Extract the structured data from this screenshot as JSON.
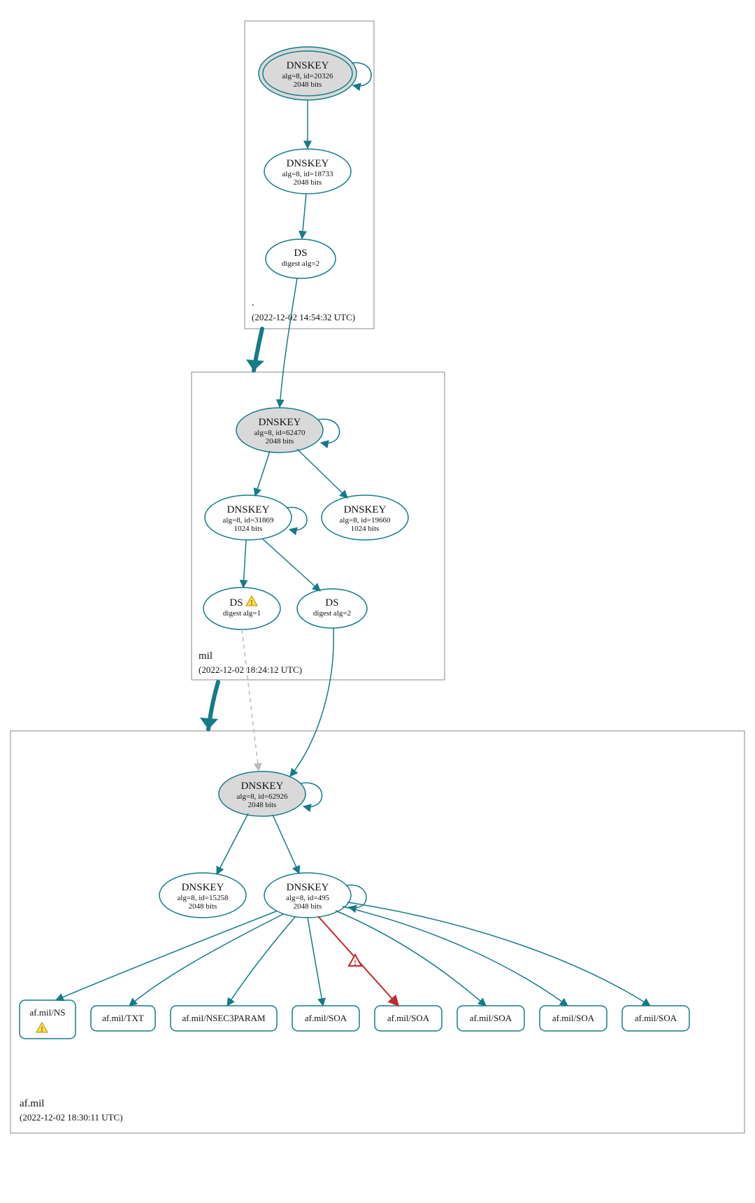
{
  "zones": {
    "root": {
      "label": ".",
      "timestamp": "(2022-12-02 14:54:32 UTC)"
    },
    "mil": {
      "label": "mil",
      "timestamp": "(2022-12-02 18:24:12 UTC)"
    },
    "afmil": {
      "label": "af.mil",
      "timestamp": "(2022-12-02 18:30:11 UTC)"
    }
  },
  "nodes": {
    "root_ksk": {
      "title": "DNSKEY",
      "sub1": "alg=8, id=20326",
      "sub2": "2048 bits"
    },
    "root_zsk": {
      "title": "DNSKEY",
      "sub1": "alg=8, id=18733",
      "sub2": "2048 bits"
    },
    "root_ds": {
      "title": "DS",
      "sub1": "digest alg=2"
    },
    "mil_ksk": {
      "title": "DNSKEY",
      "sub1": "alg=8, id=62470",
      "sub2": "2048 bits"
    },
    "mil_zsk1": {
      "title": "DNSKEY",
      "sub1": "alg=8, id=31869",
      "sub2": "1024 bits"
    },
    "mil_zsk2": {
      "title": "DNSKEY",
      "sub1": "alg=8, id=19660",
      "sub2": "1024 bits"
    },
    "mil_ds1": {
      "title": "DS",
      "sub1": "digest alg=1"
    },
    "mil_ds2": {
      "title": "DS",
      "sub1": "digest alg=2"
    },
    "af_ksk": {
      "title": "DNSKEY",
      "sub1": "alg=8, id=62926",
      "sub2": "2048 bits"
    },
    "af_zsk1": {
      "title": "DNSKEY",
      "sub1": "alg=8, id=15258",
      "sub2": "2048 bits"
    },
    "af_zsk2": {
      "title": "DNSKEY",
      "sub1": "alg=8, id=495",
      "sub2": "2048 bits"
    },
    "rr_ns": {
      "label": "af.mil/NS"
    },
    "rr_txt": {
      "label": "af.mil/TXT"
    },
    "rr_nsec3": {
      "label": "af.mil/NSEC3PARAM"
    },
    "rr_soa1": {
      "label": "af.mil/SOA"
    },
    "rr_soa2": {
      "label": "af.mil/SOA"
    },
    "rr_soa3": {
      "label": "af.mil/SOA"
    },
    "rr_soa4": {
      "label": "af.mil/SOA"
    },
    "rr_soa5": {
      "label": "af.mil/SOA"
    }
  }
}
